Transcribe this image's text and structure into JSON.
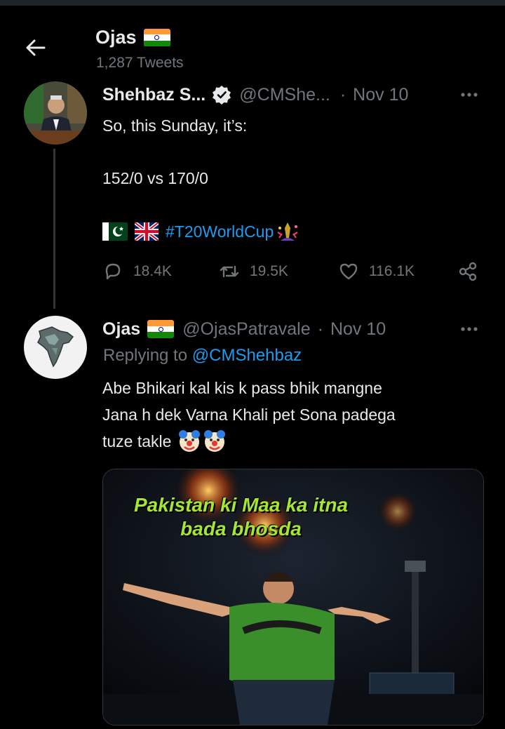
{
  "header": {
    "title": "Ojas",
    "flag_emoji": "india-flag",
    "tweet_count": "1,287 Tweets"
  },
  "tweet1": {
    "author_name": "Shehbaz S...",
    "handle": "@CMShe...",
    "separator": "·",
    "date": "Nov 10",
    "verified": true,
    "lines": [
      "So, this Sunday, it’s:",
      "152/0 vs 170/0"
    ],
    "hashtag": "#T20WorldCup",
    "flags": [
      "pakistan-flag",
      "uk-flag",
      "trophy-emoji"
    ],
    "actions": {
      "replies": "18.4K",
      "retweets": "19.5K",
      "likes": "116.1K"
    }
  },
  "tweet2": {
    "author_name": "Ojas",
    "flag_emoji": "india-flag",
    "handle": "@OjasPatravale",
    "separator": "·",
    "date": "Nov 10",
    "replying_label": "Replying to",
    "replying_handle": "@CMShehbaz",
    "lines": [
      "Abe Bhikari kal kis k pass bhik mangne",
      "Jana h dek Varna Khali pet Sona padega",
      "tuze takle"
    ],
    "emojis": [
      "clown-face-emoji",
      "clown-face-emoji"
    ],
    "media_caption_lines": [
      "Pakistan ki Maa ka itna",
      "bada bhosda"
    ]
  },
  "colors": {
    "background": "#000000",
    "text": "#e7e9ea",
    "muted": "#71767b",
    "accent": "#1d9bf0",
    "divider": "#333639"
  }
}
